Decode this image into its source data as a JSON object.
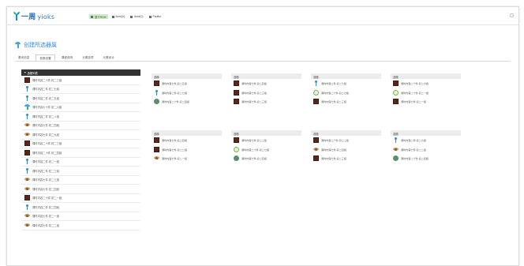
{
  "app": {
    "logo_text": "一周",
    "logo_sub": "yioks"
  },
  "nav": [
    {
      "label": "基于RDM",
      "active": true
    },
    {
      "label": "Ikunt(0)",
      "active": false
    },
    {
      "label": "Ikunt(0)",
      "active": false
    },
    {
      "label": "Pauftor",
      "active": false
    }
  ],
  "page": {
    "title": "创建所选器属"
  },
  "tabs": [
    {
      "label": "基本信息",
      "active": false
    },
    {
      "label": "参数设置",
      "active": true
    },
    {
      "label": "课程说明",
      "active": false
    },
    {
      "label": "元素选项",
      "active": false
    },
    {
      "label": "元素设计",
      "active": false
    }
  ],
  "sidebar": {
    "header": "选题列表",
    "items": [
      {
        "icon": "brown-square-thumb-icon",
        "label": "课时内容二十件 初二三组"
      },
      {
        "icon": "blue-figure-icon",
        "label": "课时内容二件 初二七组"
      },
      {
        "icon": "blue-figure-icon",
        "label": "课时内容二件 初二五组"
      },
      {
        "icon": "cup-icon",
        "label": "课时内容七十件 初二六组"
      },
      {
        "icon": "blue-figure-icon",
        "label": "课时内容二件 初二八组"
      },
      {
        "icon": "flower-icon",
        "label": "课时内容七件 初二四组"
      },
      {
        "icon": "flower-icon",
        "label": "课时内容七件 初二九组"
      },
      {
        "icon": "brown-square-thumb-icon",
        "label": "课时内容二十件 初二三组"
      },
      {
        "icon": "brown-square-thumb-icon",
        "label": "课时内容二十件 初二四组"
      },
      {
        "icon": "blue-figure-icon",
        "label": "课时内容二件 初二一组"
      },
      {
        "icon": "blue-figure-icon",
        "label": "课时内容二件 初二三组"
      },
      {
        "icon": "flower-icon",
        "label": "课时内容七件 初二三组"
      },
      {
        "icon": "flower-icon",
        "label": "课时内容七件 初二四组"
      },
      {
        "icon": "brown-square-thumb-icon",
        "label": "课时内容二十件 初二一组"
      },
      {
        "icon": "blue-figure-icon",
        "label": "课时内容二件 初二四组"
      },
      {
        "icon": "flower-icon",
        "label": "课时内容七件 初二一组"
      },
      {
        "icon": "flower-icon",
        "label": "课时内容七件 初二二组"
      }
    ]
  },
  "cards": [
    {
      "title": "选题",
      "items": [
        {
          "icon": "brown-square-thumb-icon",
          "label": "课时内容七件 初二五组"
        },
        {
          "icon": "blue-figure-icon",
          "label": "课时内容二件 初二七组"
        },
        {
          "icon": "green-round-icon",
          "label": "课时内容二十件 初二四组"
        }
      ]
    },
    {
      "title": "选题",
      "items": [
        {
          "icon": "brown-square-thumb-icon",
          "label": "课时内容七件 初二四组"
        },
        {
          "icon": "brown-square-thumb-icon",
          "label": "课时内容七件 初二三组"
        },
        {
          "icon": "brown-square-thumb-icon",
          "label": "课时内容七件 初二三组"
        }
      ]
    },
    {
      "title": "选题",
      "items": [
        {
          "icon": "blue-figure-icon",
          "label": "课时内容二件 初二七组"
        },
        {
          "icon": "green-ring-icon",
          "label": "课时内容二十件 初二七组"
        },
        {
          "icon": "brown-square-thumb-icon",
          "label": "课时内容七件 初二三组"
        }
      ]
    },
    {
      "title": "选题",
      "items": [
        {
          "icon": "brown-square-thumb-icon",
          "label": "课时内容二十件 初二六组"
        },
        {
          "icon": "green-ring-icon",
          "label": "课时内容二十件 初二一组"
        },
        {
          "icon": "brown-square-thumb-icon",
          "label": "课时内容七件 初二一组"
        }
      ]
    },
    {
      "title": "选题",
      "items": [
        {
          "icon": "brown-square-thumb-icon",
          "label": "课时内容七件 初二四组"
        },
        {
          "icon": "brown-square-thumb-icon",
          "label": "课时内容七件 初二二组"
        },
        {
          "icon": "flower-icon",
          "label": "课时内容七件 初二一组"
        }
      ]
    },
    {
      "title": "选题",
      "items": [
        {
          "icon": "brown-square-thumb-icon",
          "label": "课时内容七件 初二二组"
        },
        {
          "icon": "green-ring-icon",
          "label": "课时内容二十件 初二七组"
        },
        {
          "icon": "green-round-icon",
          "label": "课时内容七件 初二四组"
        }
      ]
    },
    {
      "title": "选题",
      "items": [
        {
          "icon": "brown-square-thumb-icon",
          "label": "课时内容二十件 初二二组"
        },
        {
          "icon": "flower-icon",
          "label": "课时内容七件 初二四组"
        },
        {
          "icon": "brown-square-thumb-icon",
          "label": "课时内容七件 初二三组"
        }
      ]
    },
    {
      "title": "选题",
      "items": [
        {
          "icon": "blue-figure-icon",
          "label": "课时内容二件 初二六组"
        },
        {
          "icon": "flower-icon",
          "label": "课时内容七件 初二二组"
        },
        {
          "icon": "green-round-icon",
          "label": "课时内容二十件 初二四组"
        }
      ]
    }
  ]
}
